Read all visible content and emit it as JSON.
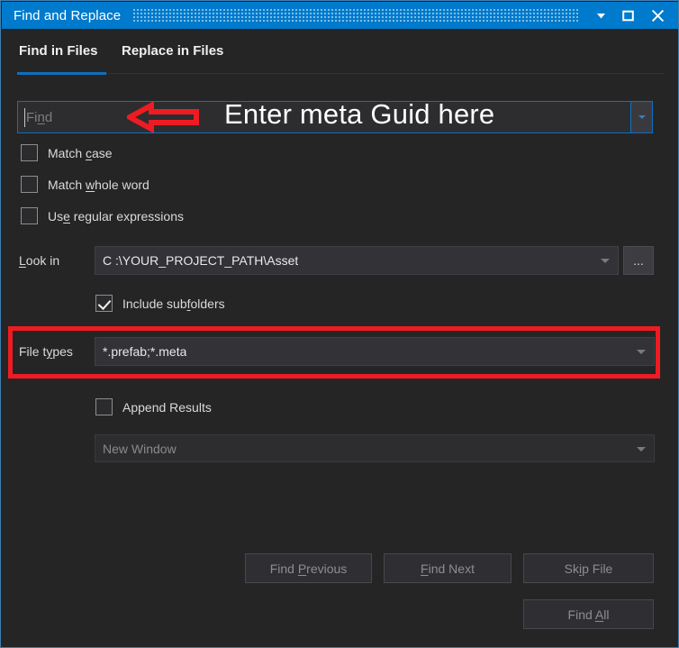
{
  "window": {
    "title": "Find and Replace",
    "controls": [
      {
        "name": "chevron-down",
        "label": "▼"
      },
      {
        "name": "maximize",
        "label": "□"
      },
      {
        "name": "close",
        "label": "✕"
      }
    ]
  },
  "tabs": [
    {
      "label": "Find in Files",
      "active": true
    },
    {
      "label": "Replace in Files",
      "active": false
    }
  ],
  "find": {
    "placeholder": "Find",
    "placeholder_pre": "Fi",
    "placeholder_accel": "n",
    "placeholder_post": "d",
    "value": ""
  },
  "annotation": {
    "text": "Enter meta Guid here",
    "arrow": "left-arrow",
    "arrow_color": "#ee1c22",
    "highlight_color": "#ee1c22"
  },
  "options": [
    {
      "name": "match-case",
      "pre": "Match ",
      "accel": "c",
      "post": "ase",
      "checked": false
    },
    {
      "name": "match-whole-word",
      "pre": "Match ",
      "accel": "w",
      "post": "hole word",
      "checked": false
    },
    {
      "name": "use-regular-expressions",
      "pre": "Us",
      "accel": "e",
      "post": " regular expressions",
      "checked": false
    }
  ],
  "look_in": {
    "label_pre": "",
    "label_accel": "L",
    "label_post": "ook in",
    "value": "C :\\YOUR_PROJECT_PATH\\Asset",
    "browse_label": "..."
  },
  "include_subfolders": {
    "pre": "Include sub",
    "accel": "f",
    "post": "olders",
    "checked": true
  },
  "file_types": {
    "label_pre": "File t",
    "label_accel": "y",
    "label_post": "pes",
    "value": "*.prefab;*.meta"
  },
  "append_results": {
    "label": "Append Results",
    "checked": false
  },
  "result_window": {
    "value": "New Window",
    "disabled": true
  },
  "buttons": [
    {
      "name": "find-previous",
      "pre": "Find ",
      "accel": "P",
      "post": "revious",
      "disabled": true
    },
    {
      "name": "find-next",
      "pre": "",
      "accel": "F",
      "post": "ind Next",
      "disabled": true
    },
    {
      "name": "skip-file",
      "pre": "Sk",
      "accel": "i",
      "post": "p File",
      "disabled": true
    },
    {
      "name": "find-all",
      "pre": "Find ",
      "accel": "A",
      "post": "ll",
      "disabled": true
    }
  ],
  "colors": {
    "titlebar": "#007acc",
    "accent": "#0e70c0",
    "dialog_bg": "#252526",
    "field_bg": "#333337"
  }
}
